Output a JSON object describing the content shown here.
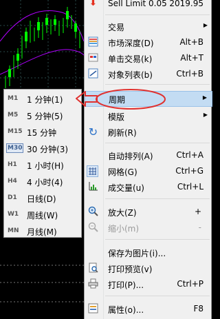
{
  "top_item": {
    "label": "Sell Limit 0.05",
    "price": "2019.95"
  },
  "menu": [
    {
      "key": "trading",
      "label": "交易",
      "shortcut": "",
      "submenu": true
    },
    {
      "key": "depth",
      "label": "市场深度(D)",
      "shortcut": "Alt+B",
      "icon": "market-depth-icon"
    },
    {
      "key": "oneclick",
      "label": "单击交易(k)",
      "shortcut": "Alt+T",
      "icon": "one-click-trading-icon"
    },
    {
      "key": "objects",
      "label": "对象列表(b)",
      "shortcut": "Ctrl+B",
      "icon": "objects-list-icon"
    },
    {
      "key": "period",
      "label": "周期",
      "shortcut": "",
      "submenu": true,
      "selected": true
    },
    {
      "key": "template",
      "label": "模版",
      "shortcut": "",
      "submenu": true
    },
    {
      "key": "refresh",
      "label": "刷新(R)",
      "shortcut": "",
      "icon": "refresh-icon"
    },
    {
      "key": "autoarrange",
      "label": "自动排列(A)",
      "shortcut": "Ctrl+A"
    },
    {
      "key": "grid",
      "label": "网格(G)",
      "shortcut": "Ctrl+G",
      "icon": "grid-icon"
    },
    {
      "key": "volumes",
      "label": "成交量(u)",
      "shortcut": "Ctrl+L",
      "icon": "volumes-icon"
    },
    {
      "key": "zoomin",
      "label": "放大(Z)",
      "shortcut": "+",
      "icon": "zoom-in-icon"
    },
    {
      "key": "zoomout",
      "label": "缩小(m)",
      "shortcut": "-",
      "icon": "zoom-out-icon",
      "disabled": true
    },
    {
      "key": "saveimg",
      "label": "保存为图片(i)...",
      "shortcut": ""
    },
    {
      "key": "preview",
      "label": "打印预览(v)",
      "shortcut": "",
      "icon": "print-preview-icon"
    },
    {
      "key": "print",
      "label": "打印(P)...",
      "shortcut": "Ctrl+P",
      "icon": "printer-icon"
    },
    {
      "key": "props",
      "label": "属性(o)...",
      "shortcut": "F8",
      "icon": "properties-icon"
    }
  ],
  "period_submenu": [
    {
      "code": "M1",
      "label": "1 分钟(1)"
    },
    {
      "code": "M5",
      "label": "5 分钟(5)"
    },
    {
      "code": "M15",
      "label": "15 分钟"
    },
    {
      "code": "M30",
      "label": "30 分钟(3)",
      "highlighted": true
    },
    {
      "code": "H1",
      "label": "1 小时(H)"
    },
    {
      "code": "H4",
      "label": "4 小时(4)"
    },
    {
      "code": "D1",
      "label": "日线(D)"
    },
    {
      "code": "W1",
      "label": "周线(W)"
    },
    {
      "code": "MN",
      "label": "月线(M)"
    }
  ],
  "colors": {
    "chart_bg": "#000000",
    "candles": "#00ff00",
    "envelope": "#b000ff",
    "grid": "#2a4a4a",
    "annotation": "#e0312f",
    "selected": "#c3dcf3"
  }
}
